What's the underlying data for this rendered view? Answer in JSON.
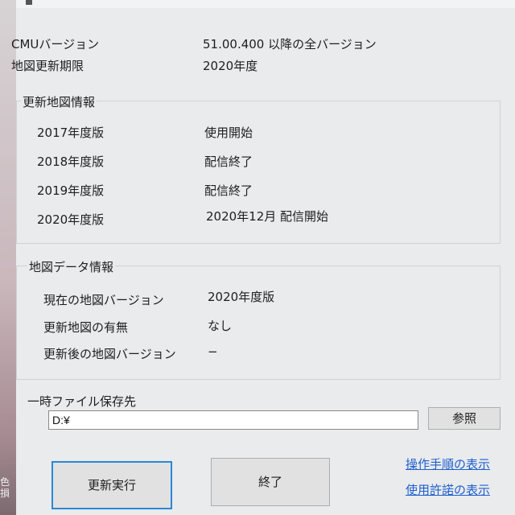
{
  "summary": {
    "cmu_label": "CMUバージョン",
    "cmu_value": "51.00.400 以降の全バージョン",
    "deadline_label": "地図更新期限",
    "deadline_value": "2020年度"
  },
  "update_info": {
    "title": "更新地図情報",
    "rows": [
      {
        "label": "2017年度版",
        "value": "使用開始"
      },
      {
        "label": "2018年度版",
        "value": "配信終了"
      },
      {
        "label": "2019年度版",
        "value": "配信終了"
      },
      {
        "label": "2020年度版",
        "value": "2020年12月 配信開始"
      }
    ]
  },
  "map_info": {
    "title": "地図データ情報",
    "rows": [
      {
        "label": "現在の地図バージョン",
        "value": "2020年度版"
      },
      {
        "label": "更新地図の有無",
        "value": "なし"
      },
      {
        "label": "更新後の地図バージョン",
        "value": "−"
      }
    ]
  },
  "temp": {
    "label": "一時ファイル保存先",
    "path_value": "D:¥",
    "browse_label": "参照"
  },
  "actions": {
    "execute_label": "更新実行",
    "exit_label": "終了",
    "link_procedure": "操作手順の表示",
    "link_license": "使用許諾の表示"
  },
  "edge_fragment": "色 損"
}
